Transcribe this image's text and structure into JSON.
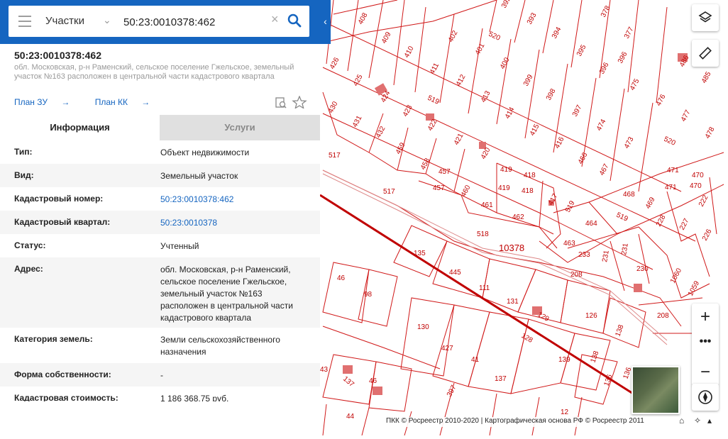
{
  "search": {
    "type_label": "Участки",
    "query": "50:23:0010378:462"
  },
  "object": {
    "number": "50:23:0010378:462",
    "address_short": "обл. Московская, р-н Раменский, сельское поселение Гжельское, земельный участок №163 расположен в центральной части кадастрового квартала"
  },
  "links": {
    "plan_zu": "План ЗУ",
    "plan_kk": "План КК"
  },
  "tabs": {
    "info": "Информация",
    "services": "Услуги"
  },
  "rows": [
    {
      "key": "Тип:",
      "value": "Объект недвижимости"
    },
    {
      "key": "Вид:",
      "value": "Земельный участок"
    },
    {
      "key": "Кадастровый номер:",
      "value": "50:23:0010378:462"
    },
    {
      "key": "Кадастровый квартал:",
      "value": "50:23:0010378"
    },
    {
      "key": "Статус:",
      "value": "Учтенный"
    },
    {
      "key": "Адрес:",
      "value": "обл. Московская, р-н Раменский, сельское поселение Гжельское, земельный участок №163 расположен в центральной части кадастрового квартала"
    },
    {
      "key": "Категория земель:",
      "value": "Земли сельскохозяйственного назначения"
    },
    {
      "key": "Форма собственности:",
      "value": "-"
    },
    {
      "key": "Кадастровая стоимость:",
      "value": "1 186 368,75 руб."
    }
  ],
  "map": {
    "quarter_label": "10378",
    "parcels": [
      "392",
      "393",
      "394",
      "395",
      "396",
      "377",
      "378",
      "408",
      "409",
      "410",
      "402",
      "401",
      "400",
      "399",
      "398",
      "397",
      "396",
      "475",
      "476",
      "486",
      "485",
      "426",
      "425",
      "424",
      "411",
      "412",
      "413",
      "414",
      "415",
      "416",
      "466",
      "474",
      "473",
      "477",
      "478",
      "430",
      "431",
      "432",
      "423",
      "422",
      "421",
      "420",
      "419",
      "418",
      "417",
      "467",
      "468",
      "471",
      "470",
      "519",
      "520",
      "517",
      "459",
      "458",
      "457",
      "460",
      "461",
      "462",
      "464",
      "469",
      "228",
      "227",
      "226",
      "222",
      "518",
      "463",
      "233",
      "231",
      "230",
      "1060",
      "1059",
      "135",
      "445",
      "111",
      "131",
      "129",
      "126",
      "208",
      "46",
      "98",
      "130",
      "427",
      "41",
      "128",
      "139",
      "138",
      "137",
      "136",
      "43",
      "12",
      "44",
      "40"
    ],
    "attribution": "ПКК © Росреестр 2010-2020 | Картографическая основа РФ © Росреестр 2011"
  }
}
